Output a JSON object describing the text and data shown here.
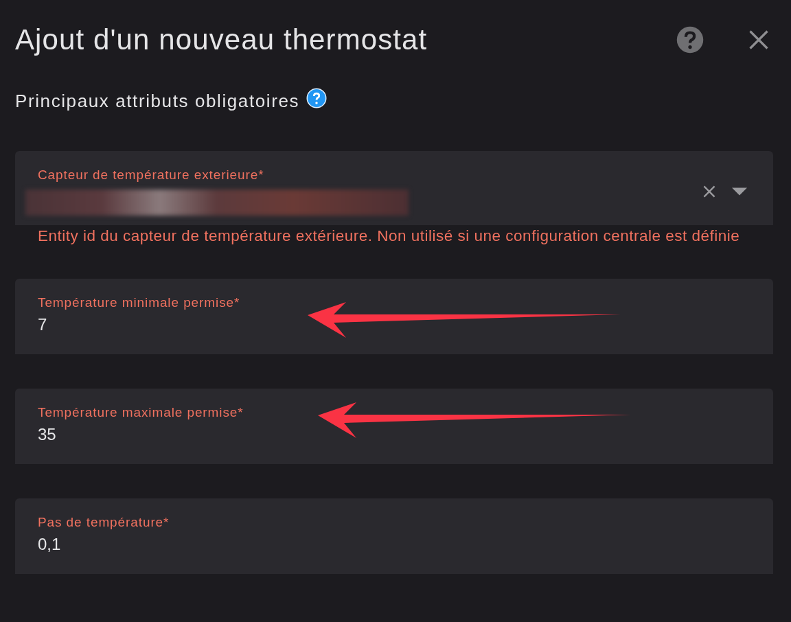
{
  "dialog": {
    "title": "Ajout d'un nouveau thermostat",
    "section_title": "Principaux attributs obligatoires"
  },
  "fields": [
    {
      "kind": "entity",
      "label": "Capteur de température exterieure*",
      "redacted": true,
      "annotated": false,
      "helper": "Entity id du capteur de température extérieure. Non utilisé si une configuration centrale est définie"
    },
    {
      "kind": "number",
      "label": "Température minimale permise*",
      "value": "7",
      "annotated": true
    },
    {
      "kind": "number",
      "label": "Température maximale permise*",
      "value": "35",
      "annotated": true
    },
    {
      "kind": "number",
      "label": "Pas de température*",
      "value": "0,1",
      "annotated": false
    }
  ]
}
